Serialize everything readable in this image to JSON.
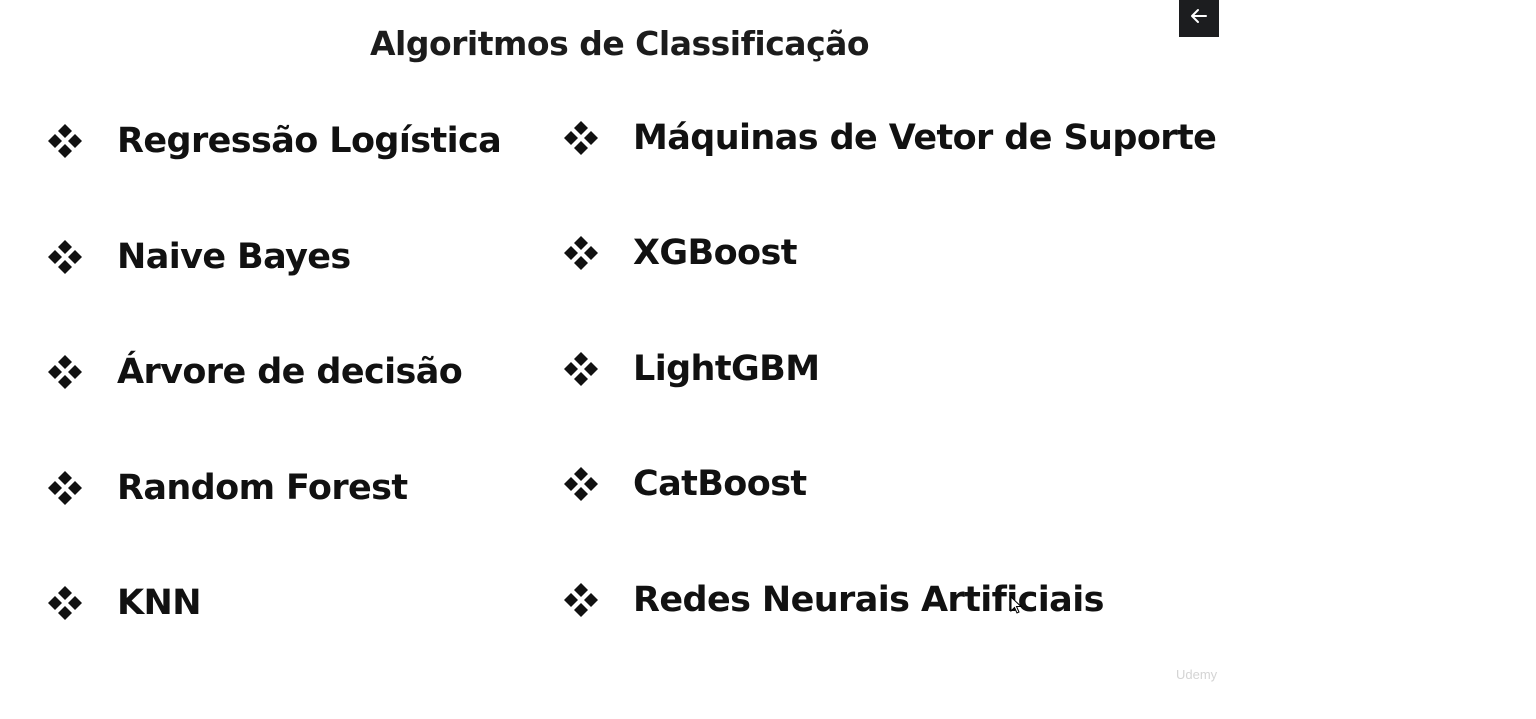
{
  "slide": {
    "title": "Algoritmos de Classificação",
    "left_column": [
      {
        "label": "Regressão Logística"
      },
      {
        "label": "Naive Bayes"
      },
      {
        "label": "Árvore de decisão"
      },
      {
        "label": "Random Forest"
      },
      {
        "label": "KNN"
      }
    ],
    "right_column": [
      {
        "label": "Máquinas de Vetor de Suporte"
      },
      {
        "label": "XGBoost"
      },
      {
        "label": "LightGBM"
      },
      {
        "label": "CatBoost"
      },
      {
        "label": "Redes Neurais Artificiais"
      }
    ],
    "bullet_icon": "four-diamond-bullet-icon"
  },
  "player": {
    "back_icon": "arrow-left-icon",
    "watermark": "Udemy"
  },
  "colors": {
    "text": "#111111",
    "background": "#ffffff",
    "back_button_bg": "#1c1d1f",
    "watermark": "#d4d4d4"
  }
}
